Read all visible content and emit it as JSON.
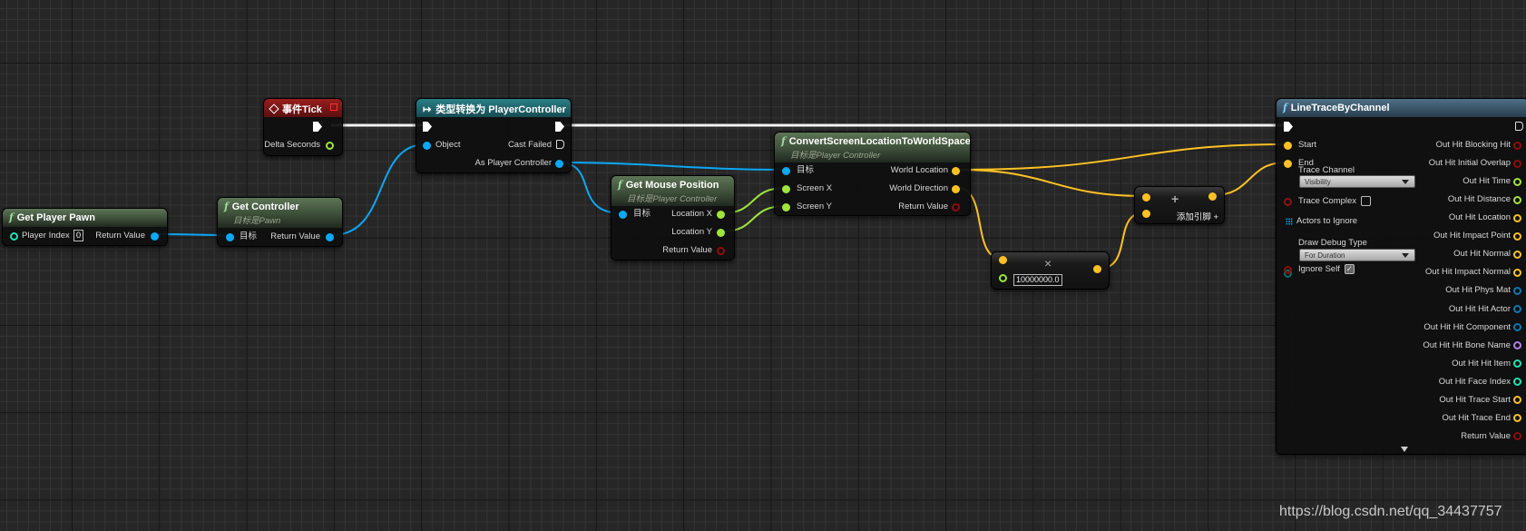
{
  "colors": {
    "exec": "#ffffff",
    "object": "#0aa8f5",
    "float": "#9ee53c",
    "vector": "#fdc123",
    "bool": "#8f0c0c",
    "int": "#1ee3b4",
    "struct": "#0a78b5",
    "name": "#b27ee6",
    "byte": "#0b6e6a"
  },
  "nodes": {
    "get_player_pawn": {
      "title": "Get Player Pawn",
      "player_index_label": "Player Index",
      "player_index_value": "0",
      "return_label": "Return Value"
    },
    "get_controller": {
      "title": "Get Controller",
      "subtitle": "目标是Pawn",
      "target_label": "目标",
      "return_label": "Return Value"
    },
    "event_tick": {
      "title": "事件Tick",
      "delta_label": "Delta Seconds"
    },
    "cast": {
      "title": "类型转换为 PlayerController",
      "object_label": "Object",
      "cast_failed_label": "Cast Failed",
      "as_pc_label": "As Player Controller"
    },
    "get_mouse_position": {
      "title": "Get Mouse Position",
      "subtitle": "目标是Player Controller",
      "target_label": "目标",
      "loc_x_label": "Location X",
      "loc_y_label": "Location Y",
      "return_label": "Return Value"
    },
    "convert": {
      "title": "ConvertScreenLocationToWorldSpace",
      "subtitle": "目标是Player Controller",
      "target_label": "目标",
      "screen_x_label": "Screen X",
      "screen_y_label": "Screen Y",
      "world_location_label": "World Location",
      "world_direction_label": "World Direction",
      "return_label": "Return Value"
    },
    "multiply": {
      "symbol": "×",
      "value": "10000000.0"
    },
    "add": {
      "symbol": "+",
      "add_pin_label": "添加引脚 +"
    },
    "line_trace": {
      "title": "LineTraceByChannel",
      "start_label": "Start",
      "end_label": "End",
      "trace_channel_label": "Trace Channel",
      "trace_channel_value": "Visibility",
      "trace_complex_label": "Trace Complex",
      "trace_complex_checked": false,
      "actors_label": "Actors to Ignore",
      "draw_debug_label": "Draw Debug Type",
      "draw_debug_value": "For Duration",
      "ignore_self_label": "Ignore Self",
      "ignore_self_checked": true,
      "outputs": [
        "Out Hit Blocking Hit",
        "Out Hit Initial Overlap",
        "Out Hit Time",
        "Out Hit Distance",
        "Out Hit Location",
        "Out Hit Impact Point",
        "Out Hit Normal",
        "Out Hit Impact Normal",
        "Out Hit Phys Mat",
        "Out Hit Hit Actor",
        "Out Hit Hit Component",
        "Out Hit Hit Bone Name",
        "Out Hit Hit Item",
        "Out Hit Face Index",
        "Out Hit Trace Start",
        "Out Hit Trace End",
        "Return Value"
      ],
      "output_types": [
        "bool",
        "bool",
        "float",
        "float",
        "vector",
        "vector",
        "vector",
        "vector",
        "struct",
        "struct",
        "struct",
        "name",
        "int",
        "int",
        "vector",
        "vector",
        "bool"
      ]
    }
  },
  "watermark": "https://blog.csdn.net/qq_34437757"
}
